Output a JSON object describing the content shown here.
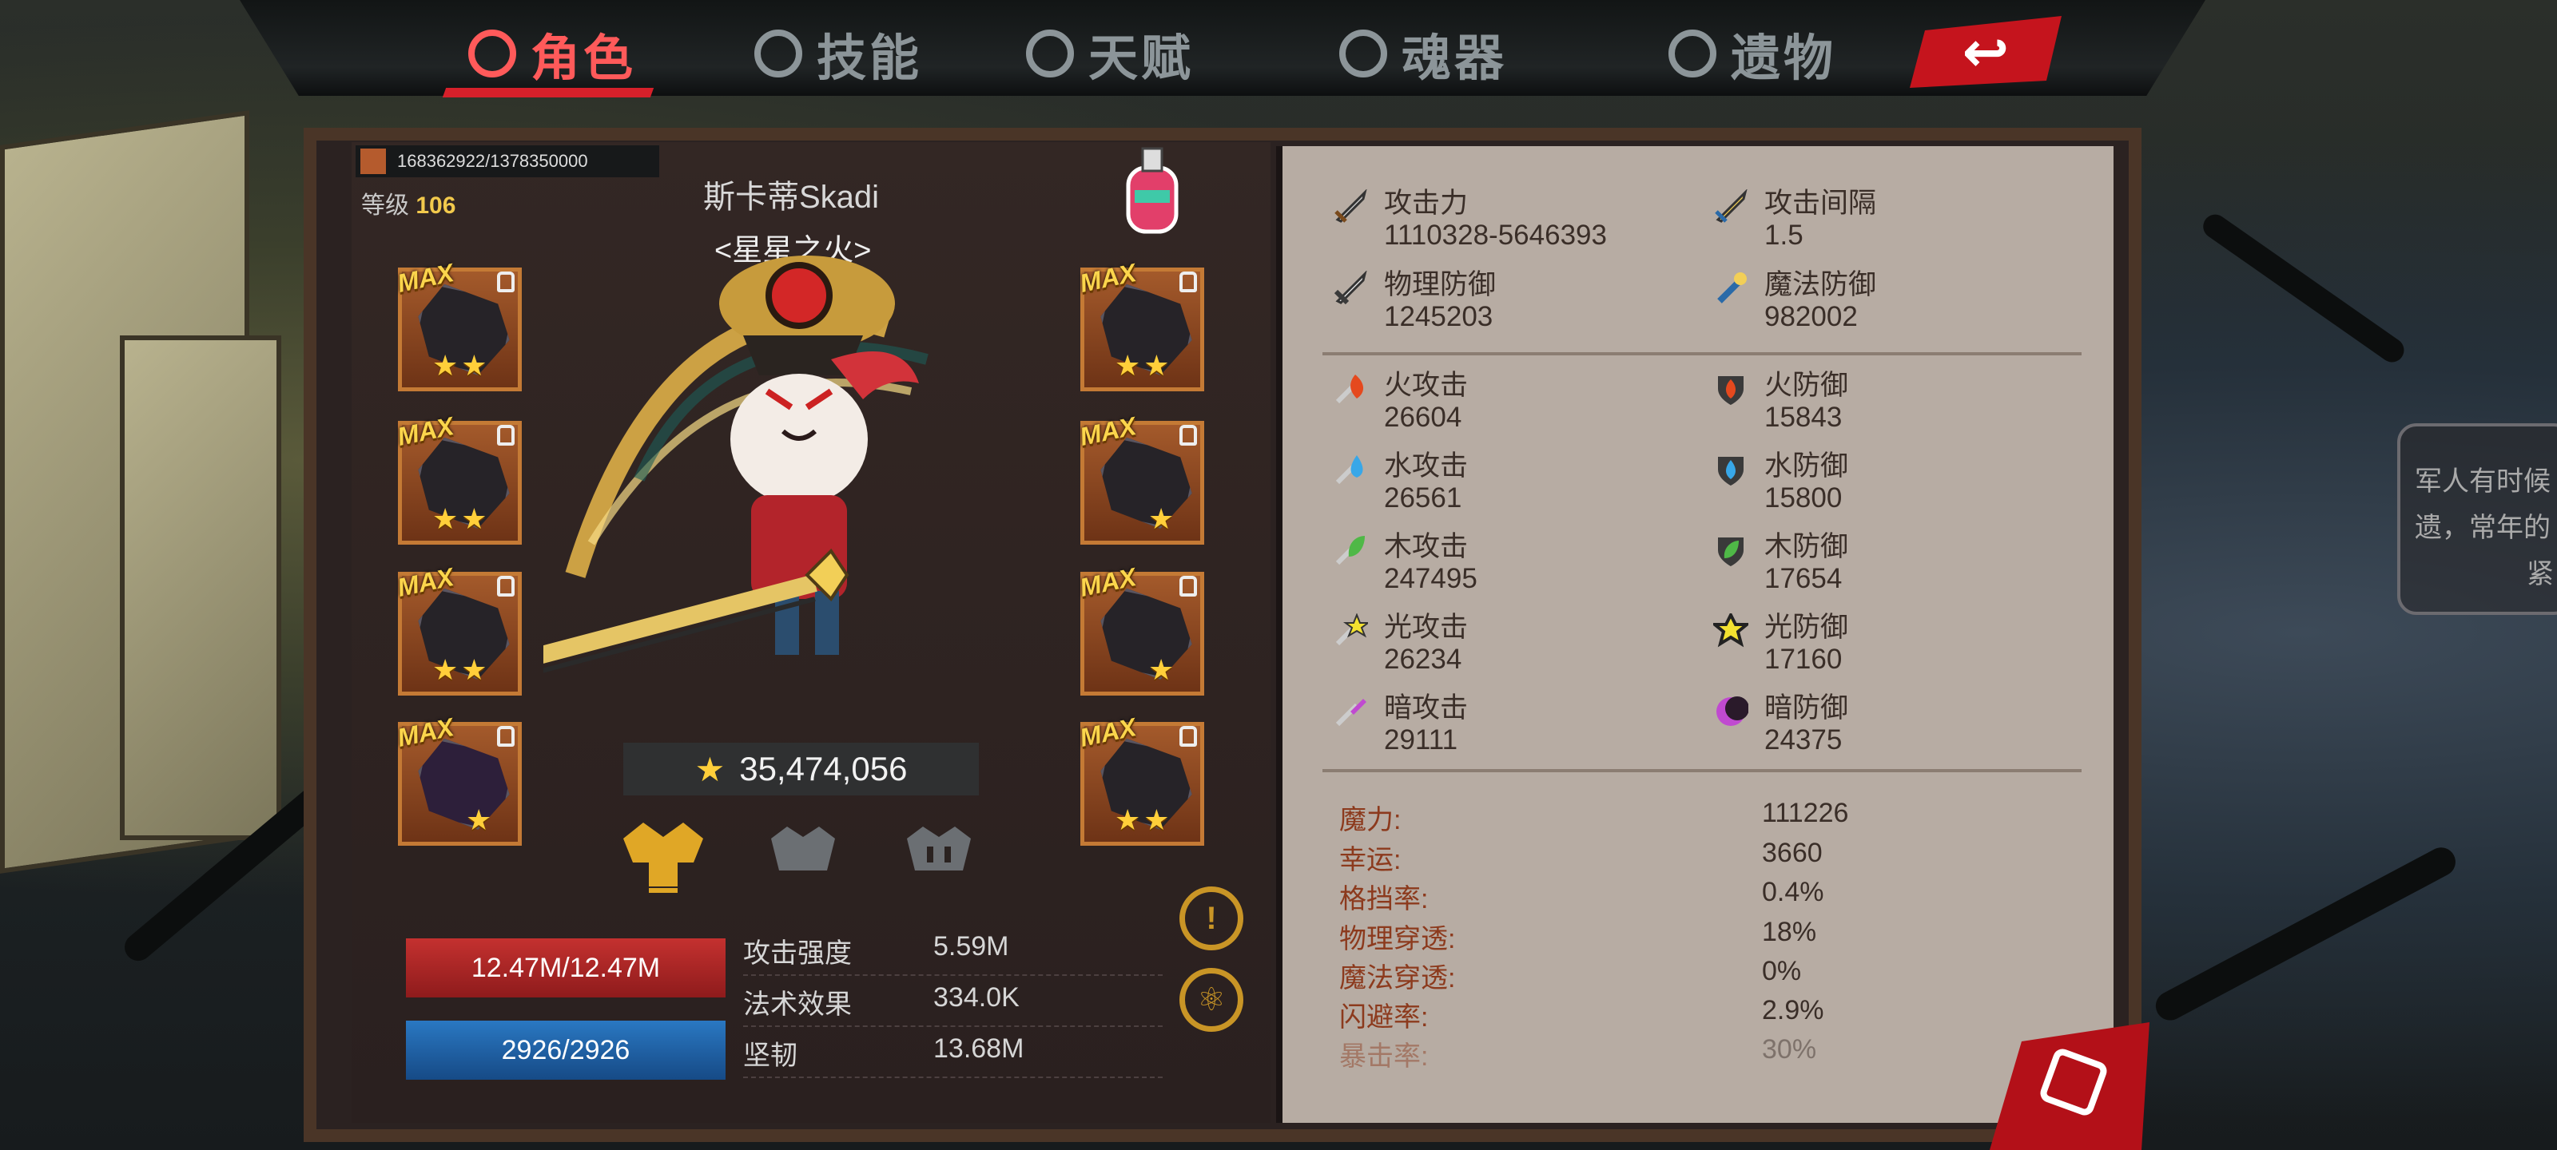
{
  "tabs": [
    {
      "label": "角色",
      "icon": "demon-face-icon",
      "active": true
    },
    {
      "label": "技能",
      "icon": "skill-swirl-icon",
      "active": false
    },
    {
      "label": "天赋",
      "icon": "talent-crest-icon",
      "active": false
    },
    {
      "label": "魂器",
      "icon": "soul-vessel-icon",
      "active": false
    },
    {
      "label": "遗物",
      "icon": "relic-swirl-icon",
      "active": false
    }
  ],
  "back_icon": "back-arrow-icon",
  "power_progress": "168362922/1378350000",
  "level": {
    "label": "等级",
    "value": "106"
  },
  "hero": {
    "name": "斯卡蒂Skadi",
    "title": "<星星之火>"
  },
  "gear_left": [
    {
      "badge": "MAX",
      "stars": 2
    },
    {
      "badge": "MAX",
      "stars": 2
    },
    {
      "badge": "MAX",
      "stars": 2
    },
    {
      "badge": "MAX",
      "stars": 1
    }
  ],
  "gear_right": [
    {
      "badge": "MAX",
      "stars": 2
    },
    {
      "badge": "MAX",
      "stars": 1
    },
    {
      "badge": "MAX",
      "stars": 1
    },
    {
      "badge": "MAX",
      "stars": 2
    }
  ],
  "star_glyph": "★",
  "score": "35,474,056",
  "hp": "12.47M/12.47M",
  "mp": "2926/2926",
  "substats": [
    {
      "label": "攻击强度",
      "value": "5.59M"
    },
    {
      "label": "法术效果",
      "value": "334.0K"
    },
    {
      "label": "坚韧",
      "value": "13.68M"
    }
  ],
  "round_buttons": [
    "!",
    "⚛"
  ],
  "stats_top": [
    {
      "label": "攻击力",
      "value": "1110328-5646393",
      "icon": "sword-icon"
    },
    {
      "label": "攻击间隔",
      "value": "1.5",
      "icon": "golden-sword-icon"
    },
    {
      "label": "物理防御",
      "value": "1245203",
      "icon": "shield-sword-icon"
    },
    {
      "label": "魔法防御",
      "value": "982002",
      "icon": "magic-wand-icon"
    }
  ],
  "stats_elem": [
    {
      "label": "火攻击",
      "value": "26604",
      "icon": "fire-attack-icon"
    },
    {
      "label": "火防御",
      "value": "15843",
      "icon": "fire-defense-icon"
    },
    {
      "label": "水攻击",
      "value": "26561",
      "icon": "water-attack-icon"
    },
    {
      "label": "水防御",
      "value": "15800",
      "icon": "water-defense-icon"
    },
    {
      "label": "木攻击",
      "value": "247495",
      "icon": "wood-attack-icon"
    },
    {
      "label": "木防御",
      "value": "17654",
      "icon": "wood-defense-icon"
    },
    {
      "label": "光攻击",
      "value": "26234",
      "icon": "light-attack-icon"
    },
    {
      "label": "光防御",
      "value": "17160",
      "icon": "light-defense-icon"
    },
    {
      "label": "暗攻击",
      "value": "29111",
      "icon": "dark-attack-icon"
    },
    {
      "label": "暗防御",
      "value": "24375",
      "icon": "dark-defense-icon"
    }
  ],
  "props": [
    {
      "label": "魔力:",
      "value": "111226"
    },
    {
      "label": "幸运:",
      "value": "3660"
    },
    {
      "label": "格挡率:",
      "value": "0.4%"
    },
    {
      "label": "物理穿透:",
      "value": "18%"
    },
    {
      "label": "魔法穿透:",
      "value": "0%"
    },
    {
      "label": "闪避率:",
      "value": "2.9%"
    },
    {
      "label": "暴击率:",
      "value": "30%"
    }
  ],
  "tooltip_lines": [
    "军人有时候",
    "遗，常年的",
    "紧"
  ],
  "colors": {
    "accent_red": "#d6202a",
    "gold": "#f2c94c",
    "hp": "#c4312f",
    "mp": "#2a78c2"
  }
}
